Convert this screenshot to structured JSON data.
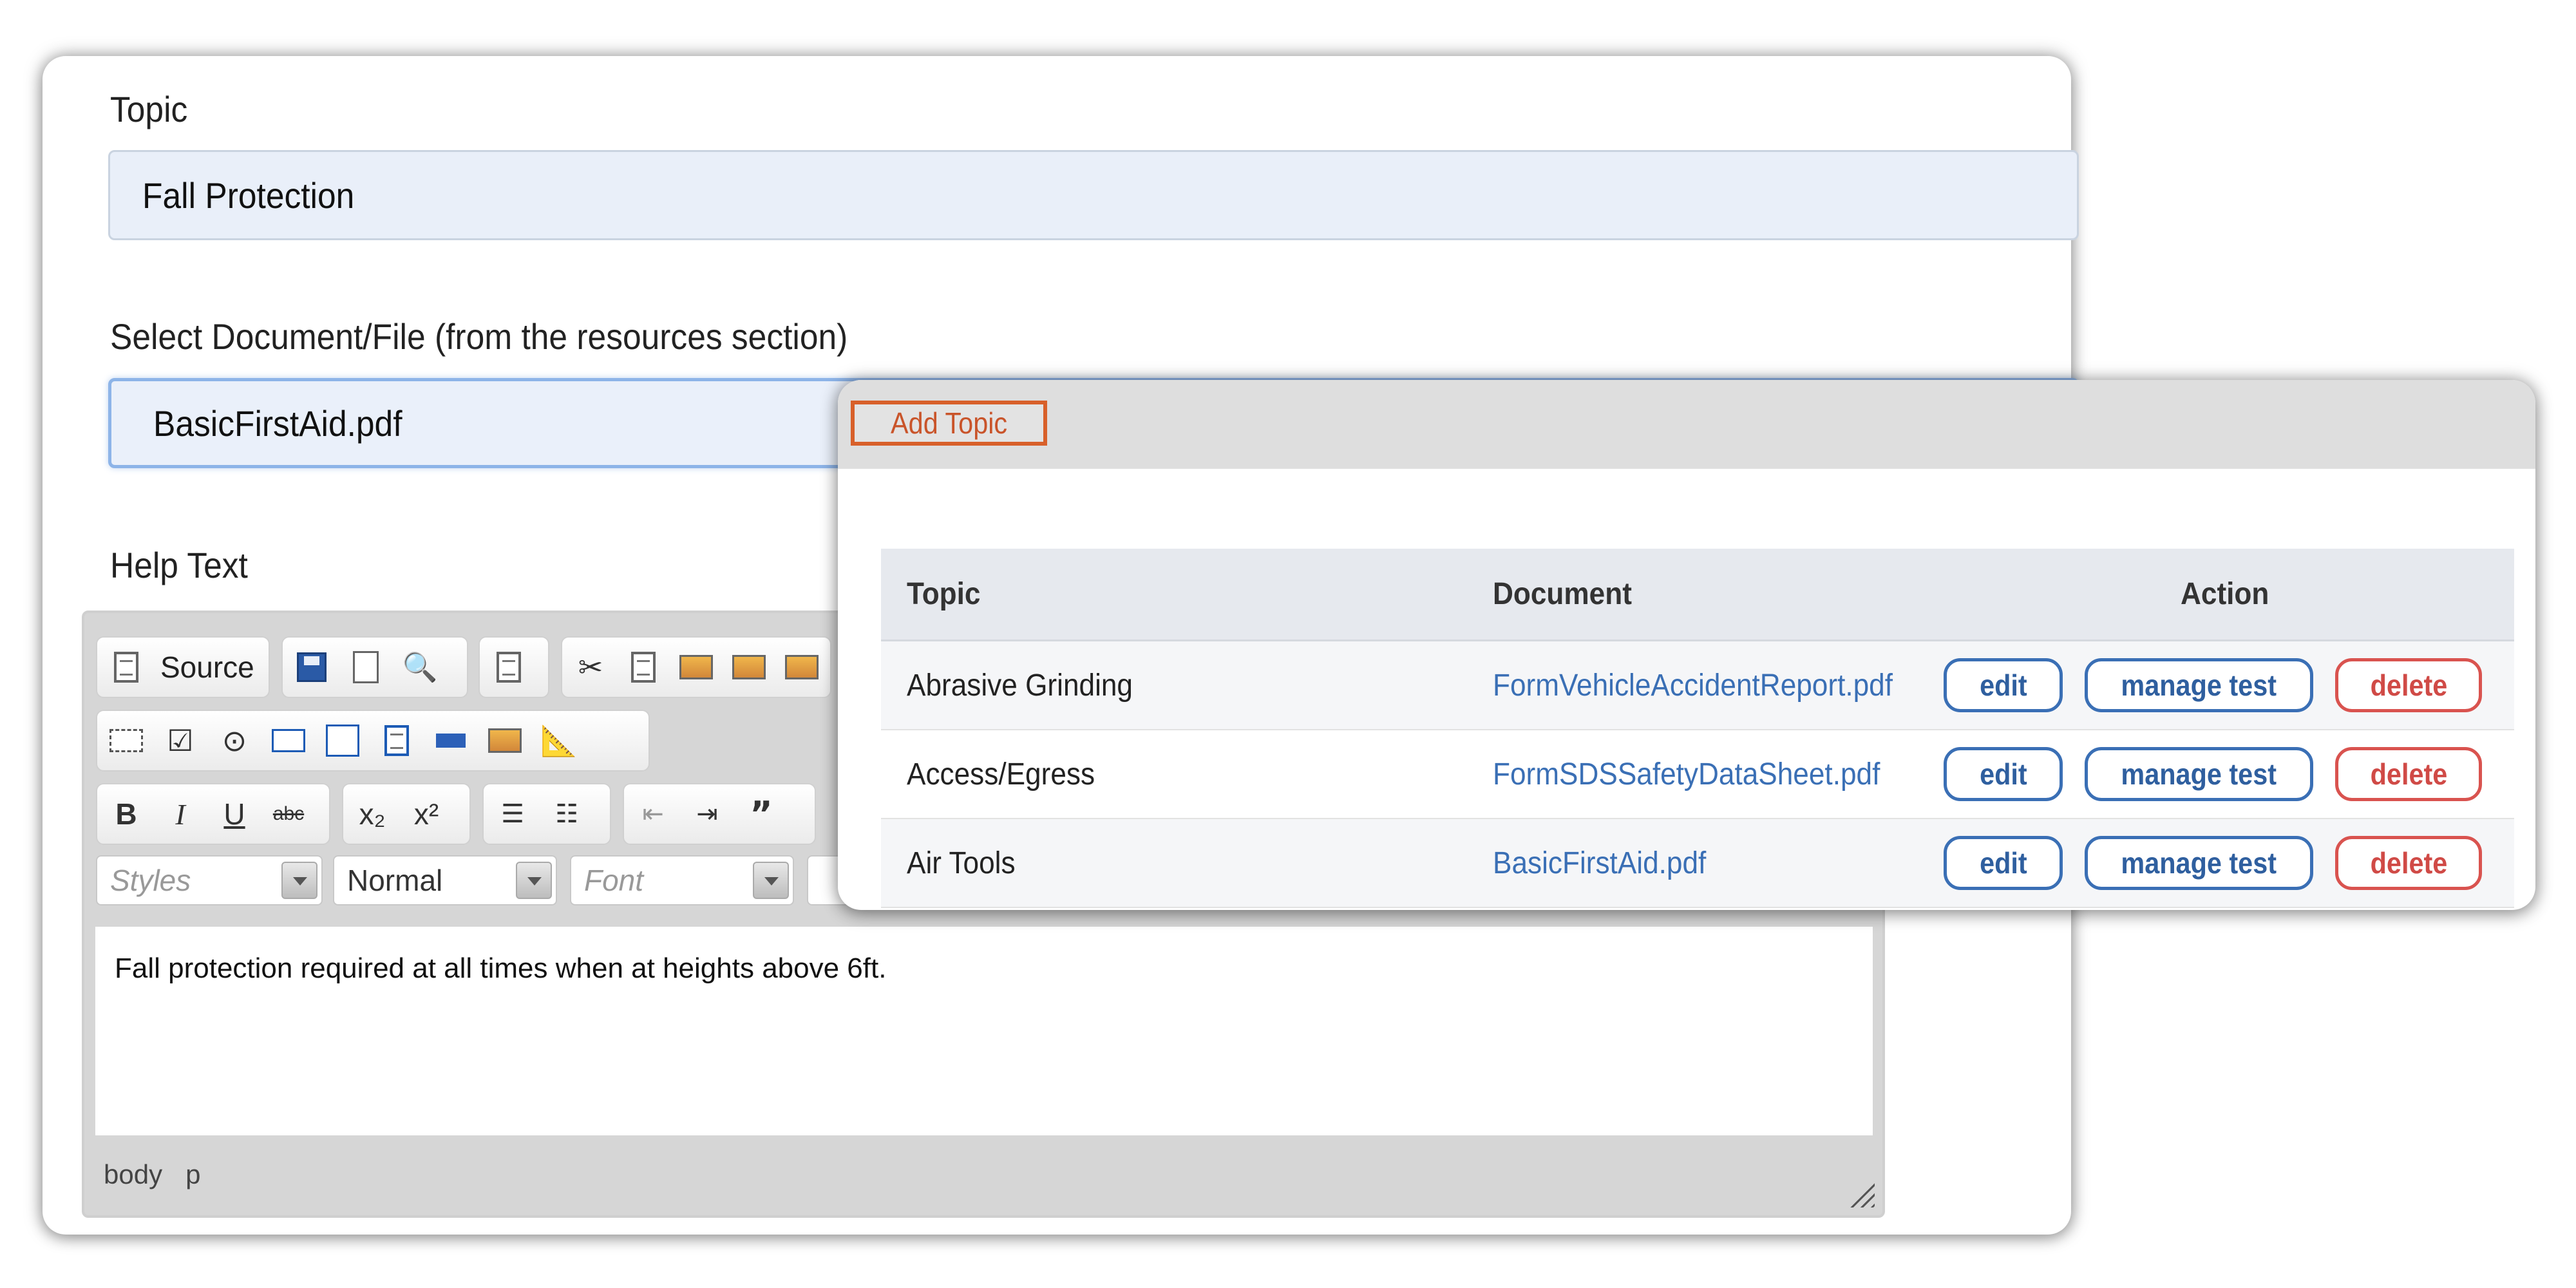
{
  "form": {
    "topic_label": "Topic",
    "topic_value": "Fall Protection",
    "document_label": "Select Document/File (from the resources section)",
    "document_value": "BasicFirstAid.pdf",
    "help_label": "Help Text"
  },
  "editor": {
    "source_label": "Source",
    "styles_placeholder": "Styles",
    "format_value": "Normal",
    "font_placeholder": "Font",
    "content": "Fall protection required at all times when at heights above 6ft.",
    "path": [
      "body",
      "p"
    ],
    "icons": {
      "row1": [
        "source-icon",
        "save-icon",
        "new-page-icon",
        "preview-icon",
        "templates-icon",
        "cut-icon",
        "copy-icon",
        "paste-icon",
        "paste-text-icon",
        "paste-word-icon"
      ],
      "row2": [
        "form-icon",
        "checkbox-icon",
        "radio-icon",
        "text-field-icon",
        "textarea-icon",
        "select-icon",
        "button-icon",
        "image-button-icon",
        "hidden-field-icon"
      ],
      "row3": [
        "bold-icon",
        "italic-icon",
        "underline-icon",
        "strikethrough-icon",
        "subscript-icon",
        "superscript-icon",
        "numbered-list-icon",
        "bulleted-list-icon",
        "outdent-icon",
        "indent-icon",
        "blockquote-icon"
      ]
    }
  },
  "popup": {
    "add_topic_label": "Add Topic",
    "columns": [
      "Topic",
      "Document",
      "Action"
    ],
    "rows": [
      {
        "topic": "Abrasive Grinding",
        "document": "FormVehicleAccidentReport.pdf"
      },
      {
        "topic": "Access/Egress",
        "document": "FormSDSSafetyDataSheet.pdf"
      },
      {
        "topic": "Air Tools",
        "document": "BasicFirstAid.pdf"
      }
    ],
    "actions": {
      "edit": "edit",
      "manage": "manage test",
      "delete": "delete"
    }
  },
  "colors": {
    "accent_orange": "#d8602a",
    "link_blue": "#3a6fb5",
    "delete_red": "#d9534f",
    "field_bg": "#e9eff9"
  }
}
